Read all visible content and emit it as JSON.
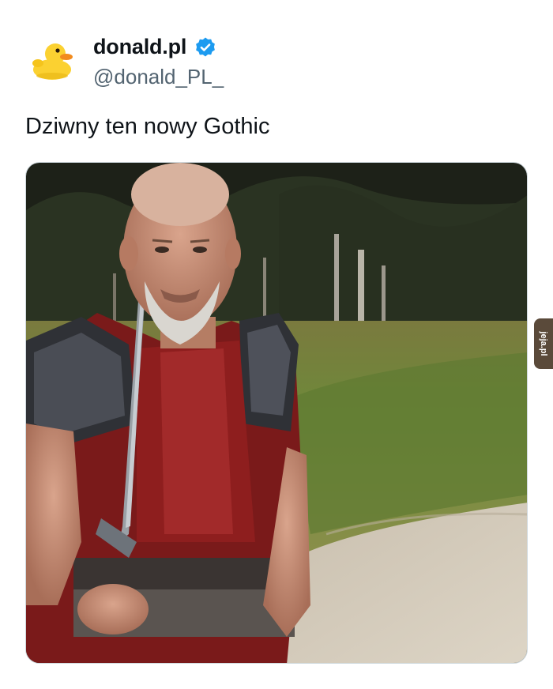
{
  "tweet": {
    "display_name": "donald.pl",
    "handle": "@donald_PL_",
    "text": "Dziwny ten nowy Gothic",
    "verified": true,
    "avatar_icon": "rubber-duck-icon",
    "verified_icon": "verified-badge-icon"
  },
  "watermark": {
    "text": "jeja.pl",
    "icon": "jeja-watermark-logo"
  },
  "colors": {
    "text_primary": "#0f1419",
    "text_secondary": "#536471",
    "verified_blue": "#1d9bf0",
    "duck_yellow": "#fbd131",
    "beak_orange": "#f28b1e"
  }
}
